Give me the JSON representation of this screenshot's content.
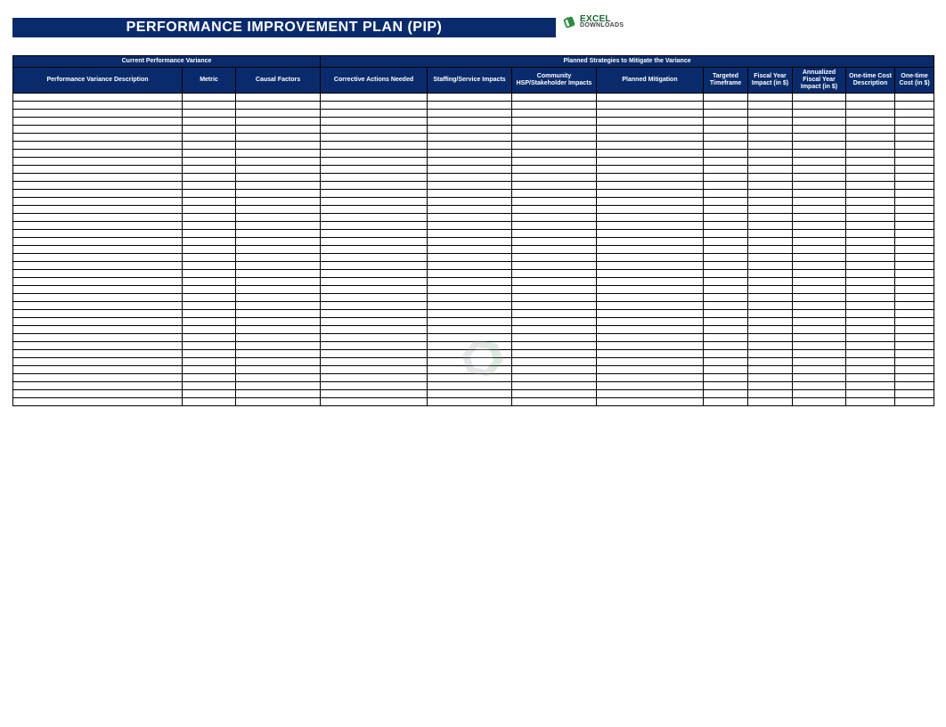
{
  "title": "PERFORMANCE IMPROVEMENT PLAN (PIP)",
  "logo": {
    "line1": "EXCEL",
    "line2": "DOWNLOADS"
  },
  "group_headers": {
    "left": "Current Performance Variance",
    "right": "Planned Strategies to Mitigate the Variance"
  },
  "columns": {
    "c1": "Performance Variance Description",
    "c2": "Metric",
    "c3": "Causal Factors",
    "c4": "Corrective Actions Needed",
    "c5": "Staffing/Service Impacts",
    "c6": "Community HSP/Stakeholder Impacts",
    "c7": "Planned Mitigation",
    "c8": "Targeted Timeframe",
    "c9": "Fiscal Year Impact (in $)",
    "c10": "Annualized Fiscal Year Impact (in $)",
    "c11": "One-time Cost Description",
    "c12": "One-time Cost (in $)"
  },
  "row_heights": [
    "n",
    "n",
    "n",
    "n",
    "n",
    "n",
    "n",
    "tall",
    "n",
    "n",
    "tall",
    "xtall",
    "n",
    "n",
    "n",
    "sm",
    "n",
    "n",
    "n",
    "n",
    "n",
    "n",
    "n",
    "n",
    "n",
    "n",
    "n",
    "n",
    "n",
    "n",
    "n",
    "n",
    "n",
    "n",
    "n",
    "n",
    "n",
    "n",
    "n"
  ]
}
